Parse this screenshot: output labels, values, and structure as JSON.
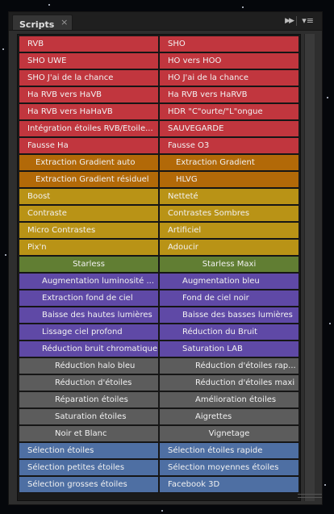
{
  "panel": {
    "tab_label": "Scripts",
    "close_icon": "×",
    "collapse_icon": "▶▶",
    "menu_icon": "▾≡"
  },
  "colors": {
    "red": "#c1363e",
    "orange": "#b26908",
    "yellow": "#b99316",
    "green": "#617e33",
    "purple": "#5f49a6",
    "gray": "#5c5c5c",
    "blue": "#4e6fa3"
  },
  "buttons": [
    {
      "label": "RVB",
      "color": "red"
    },
    {
      "label": "SHO",
      "color": "red"
    },
    {
      "label": "SHO UWE",
      "color": "red"
    },
    {
      "label": "HO vers HOO",
      "color": "red"
    },
    {
      "label": "SHO J'ai de la chance",
      "color": "red"
    },
    {
      "label": "HO J'ai de la chance",
      "color": "red"
    },
    {
      "label": "Ha RVB vers HaVB",
      "color": "red"
    },
    {
      "label": "Ha RVB vers HaRVB",
      "color": "red"
    },
    {
      "label": "Ha RVB vers HaHaVB",
      "color": "red"
    },
    {
      "label": "HDR \"C\"ourte/\"L\"ongue",
      "color": "red"
    },
    {
      "label": "Intégration étoiles RVB/Etoile...",
      "color": "red"
    },
    {
      "label": "SAUVEGARDE",
      "color": "red"
    },
    {
      "label": "Fausse Ha",
      "color": "red"
    },
    {
      "label": "Fausse O3",
      "color": "red"
    },
    {
      "label": "Extraction Gradient auto",
      "color": "orange"
    },
    {
      "label": "Extraction Gradient",
      "color": "orange"
    },
    {
      "label": "Extraction Gradient résiduel",
      "color": "orange"
    },
    {
      "label": "HLVG",
      "color": "orange"
    },
    {
      "label": "Boost",
      "color": "yellow"
    },
    {
      "label": "Netteté",
      "color": "yellow"
    },
    {
      "label": "Contraste",
      "color": "yellow"
    },
    {
      "label": "Contrastes Sombres",
      "color": "yellow"
    },
    {
      "label": "Micro Contrastes",
      "color": "yellow"
    },
    {
      "label": "Artificiel",
      "color": "yellow"
    },
    {
      "label": "Pix'n",
      "color": "yellow"
    },
    {
      "label": "Adoucir",
      "color": "yellow"
    },
    {
      "label": "Starless",
      "color": "green"
    },
    {
      "label": "Starless Maxi",
      "color": "green"
    },
    {
      "label": "Augmentation luminosité ...",
      "color": "purple"
    },
    {
      "label": "Augmentation bleu",
      "color": "purple"
    },
    {
      "label": "Extraction fond de ciel",
      "color": "purple"
    },
    {
      "label": "Fond de ciel noir",
      "color": "purple"
    },
    {
      "label": "Baisse des hautes lumières",
      "color": "purple"
    },
    {
      "label": "Baisse des basses lumières",
      "color": "purple"
    },
    {
      "label": "Lissage ciel profond",
      "color": "purple"
    },
    {
      "label": "Réduction du Bruit",
      "color": "purple"
    },
    {
      "label": "Réduction bruit chromatique",
      "color": "purple"
    },
    {
      "label": "Saturation LAB",
      "color": "purple"
    },
    {
      "label": "Réduction halo bleu",
      "color": "gray"
    },
    {
      "label": "Réduction d'étoiles rap...",
      "color": "gray"
    },
    {
      "label": "Réduction d'étoiles",
      "color": "gray"
    },
    {
      "label": "Réduction d'étoiles maxi",
      "color": "gray"
    },
    {
      "label": "Réparation étoiles",
      "color": "gray"
    },
    {
      "label": "Amélioration étoiles",
      "color": "gray"
    },
    {
      "label": "Saturation étoiles",
      "color": "gray"
    },
    {
      "label": "Aigrettes",
      "color": "gray"
    },
    {
      "label": "Noir et Blanc",
      "color": "gray"
    },
    {
      "label": "Vignetage",
      "color": "gray"
    },
    {
      "label": "Sélection étoiles",
      "color": "blue"
    },
    {
      "label": "Sélection étoiles rapide",
      "color": "blue"
    },
    {
      "label": "Sélection petites étoiles",
      "color": "blue"
    },
    {
      "label": "Sélection moyennes étoiles",
      "color": "blue"
    },
    {
      "label": "Sélection grosses étoiles",
      "color": "blue"
    },
    {
      "label": "Facebook 3D",
      "color": "blue"
    }
  ]
}
